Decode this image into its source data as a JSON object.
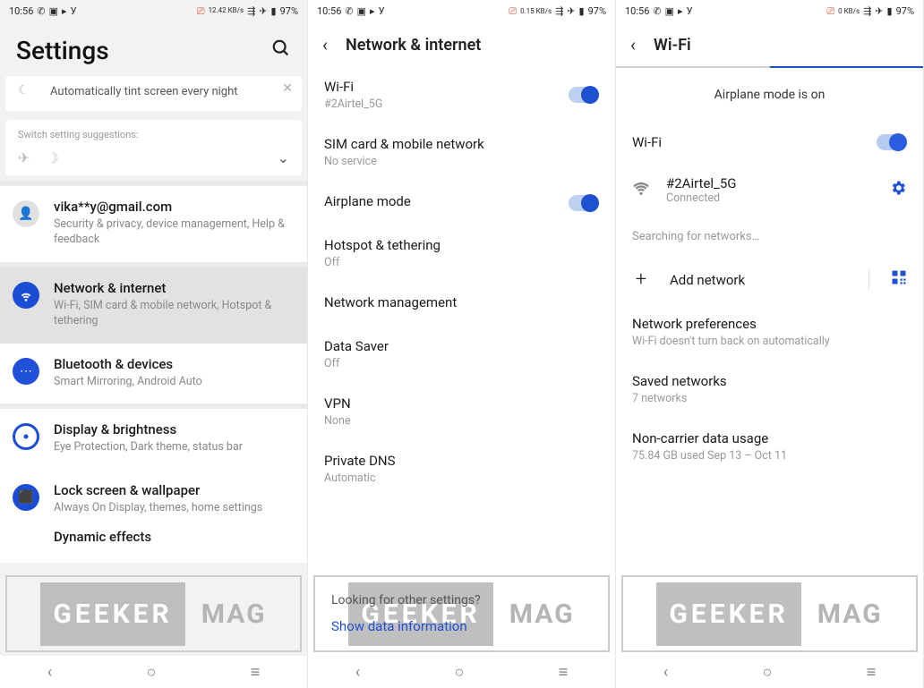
{
  "statusbar": {
    "time": "10:56",
    "net2": "12.42 KB/s",
    "net3_a": "0.15 KB/s",
    "net3_b": "0 KB/s",
    "battery": "97%",
    "y_label": "У"
  },
  "pane1": {
    "title": "Settings",
    "tint_text": "Automatically tint screen every night",
    "suggest_label": "Switch setting suggestions:",
    "account": {
      "title": "vika**y@gmail.com",
      "sub": "Security & privacy, device management, Help & feedback"
    },
    "network": {
      "title": "Network & internet",
      "sub": "Wi-Fi, SIM card & mobile network, Hotspot & tethering"
    },
    "bluetooth": {
      "title": "Bluetooth & devices",
      "sub": "Smart Mirroring, Android Auto"
    },
    "display": {
      "title": "Display & brightness",
      "sub": "Eye Protection, Dark theme, status bar"
    },
    "lock": {
      "title": "Lock screen & wallpaper",
      "sub": "Always On Display, themes, home settings"
    },
    "dynamic": {
      "title": "Dynamic effects"
    }
  },
  "pane2": {
    "title": "Network & internet",
    "wifi": {
      "t": "Wi-Fi",
      "s": "#2Airtel_5G"
    },
    "sim": {
      "t": "SIM card & mobile network",
      "s": "No service"
    },
    "airplane": {
      "t": "Airplane mode"
    },
    "hotspot": {
      "t": "Hotspot & tethering",
      "s": "Off"
    },
    "netmgmt": {
      "t": "Network management"
    },
    "datasaver": {
      "t": "Data Saver",
      "s": "Off"
    },
    "vpn": {
      "t": "VPN",
      "s": "None"
    },
    "dns": {
      "t": "Private DNS",
      "s": "Automatic"
    },
    "looking": "Looking for other settings?",
    "show_data": "Show data information"
  },
  "pane3": {
    "title": "Wi-Fi",
    "banner": "Airplane mode is on",
    "wifi_label": "Wi-Fi",
    "network": {
      "name": "#2Airtel_5G",
      "status": "Connected"
    },
    "searching": "Searching for networks…",
    "add_network": "Add network",
    "prefs": {
      "t": "Network preferences",
      "s": "Wi-Fi doesn't turn back on automatically"
    },
    "saved": {
      "t": "Saved networks",
      "s": "7 networks"
    },
    "usage": {
      "t": "Non-carrier data usage",
      "s": "75.84 GB used Sep 13 – Oct 11"
    }
  },
  "watermark": {
    "geeker": "GEEKER",
    "mag": "MAG"
  }
}
